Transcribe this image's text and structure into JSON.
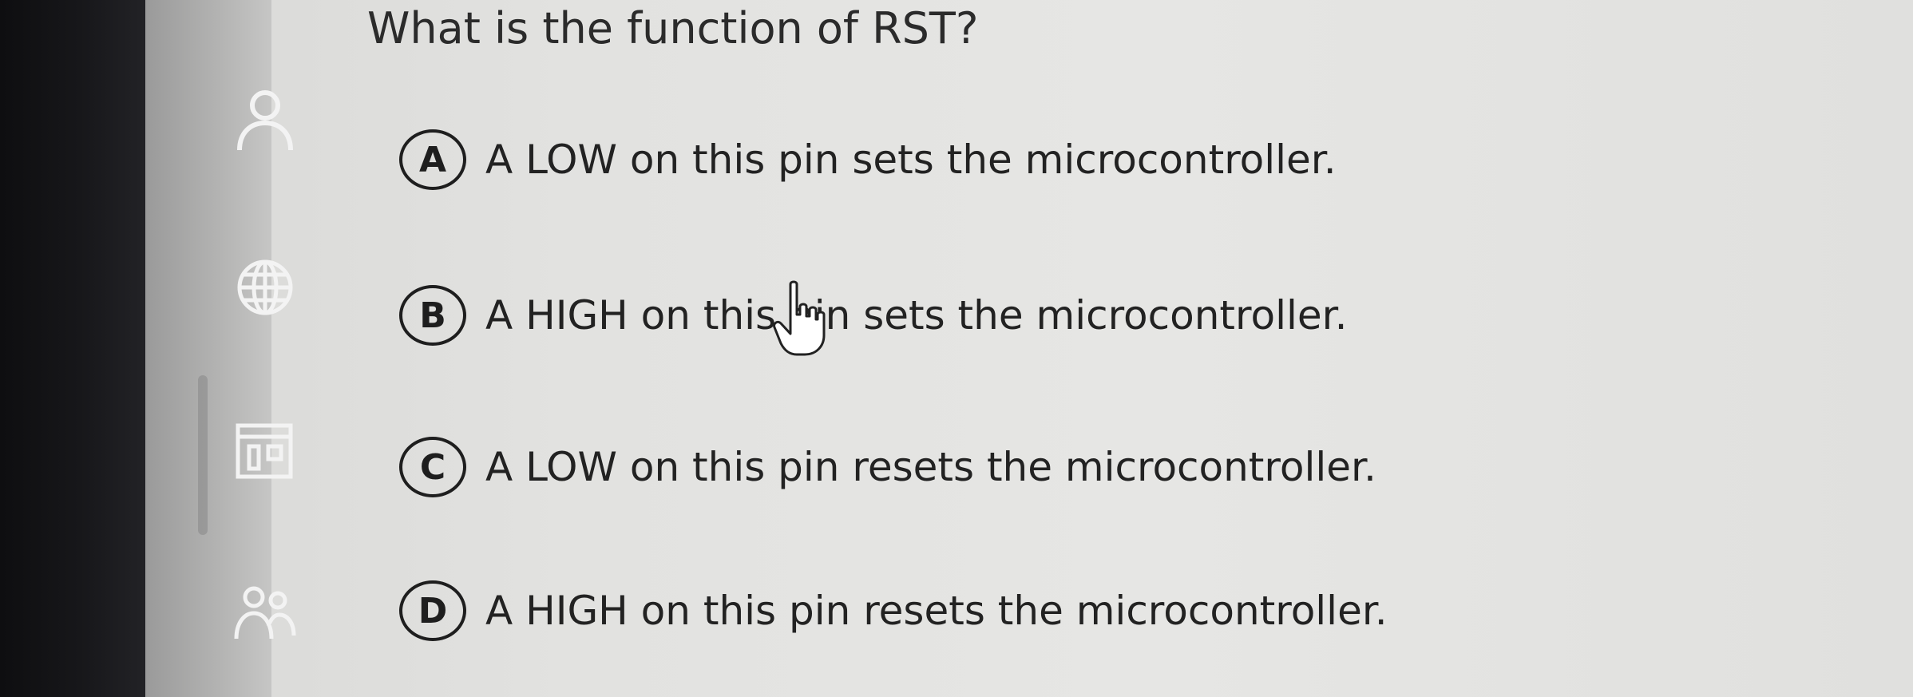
{
  "question": {
    "text": "What is the function of RST?"
  },
  "options": [
    {
      "letter": "A",
      "text": "A LOW on this pin sets the microcontroller."
    },
    {
      "letter": "B",
      "text": "A HIGH on this pin sets the microcontroller."
    },
    {
      "letter": "C",
      "text": "A LOW on this pin resets the microcontroller."
    },
    {
      "letter": "D",
      "text": "A HIGH on this pin resets the microcontroller."
    }
  ],
  "sidebar": {
    "icons": [
      "person-icon",
      "globe-icon",
      "calendar-icon",
      "people-icon"
    ]
  },
  "cursor": {
    "icon": "hand-pointer-icon"
  },
  "colors": {
    "bezel": "#141416",
    "sidebar": "#b0b0af",
    "background": "#e2e2e0",
    "text": "#222222"
  }
}
